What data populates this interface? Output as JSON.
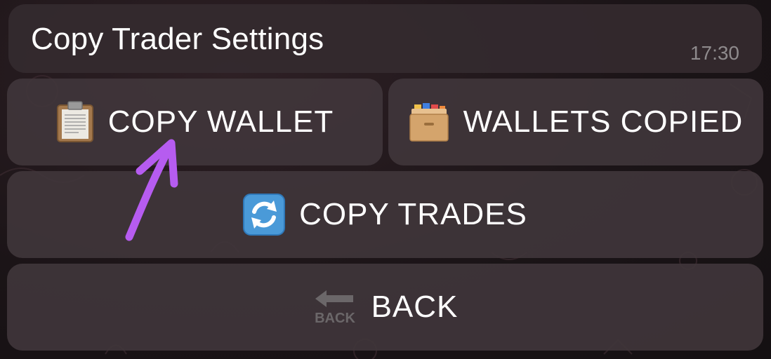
{
  "message": {
    "text": "Copy Trader Settings",
    "time": "17:30"
  },
  "keyboard": {
    "copy_wallet": {
      "label": "COPY WALLET",
      "icon": "clipboard-icon"
    },
    "wallets_copied": {
      "label": "WALLETS COPIED",
      "icon": "card-file-box-icon"
    },
    "copy_trades": {
      "label": "COPY TRADES",
      "icon": "refresh-arrows-icon"
    },
    "back": {
      "label": "BACK",
      "icon": "back-arrow-icon",
      "icon_text": "BACK"
    }
  },
  "annotation": {
    "icon": "purple-arrow-annotation",
    "color": "#b65cf0"
  }
}
